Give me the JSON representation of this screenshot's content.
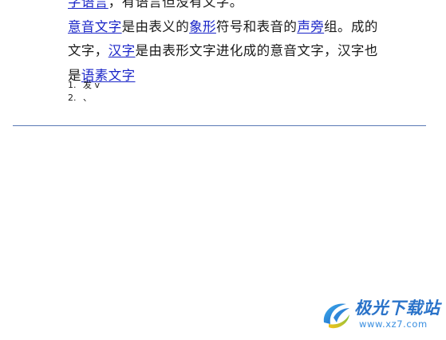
{
  "document": {
    "lines": [
      {
        "segments": [
          {
            "text": "字语言",
            "link": true
          },
          {
            "text": "，有语言但没有文字。",
            "link": false
          }
        ]
      },
      {
        "segments": [
          {
            "text": "意音文字",
            "link": true
          },
          {
            "text": "是由表义的",
            "link": false
          },
          {
            "text": "象形",
            "link": true
          },
          {
            "text": "符号和表音的",
            "link": false
          },
          {
            "text": "声旁",
            "link": true
          },
          {
            "text": "组。成的",
            "link": false
          }
        ]
      },
      {
        "segments": [
          {
            "text": "文字，",
            "link": false
          },
          {
            "text": "汉字",
            "link": true
          },
          {
            "text": "是由表形文字进化成的意音文字，汉字也",
            "link": false
          }
        ]
      },
      {
        "segments": [
          {
            "text": "是",
            "link": false
          },
          {
            "text": "语素文字",
            "link": true
          }
        ]
      }
    ],
    "list": [
      {
        "number": "1.",
        "text": "发 v"
      },
      {
        "number": "2.",
        "text": "、"
      }
    ]
  },
  "watermark": {
    "brand": "极光下载站",
    "url": "www.xz7.com"
  },
  "colors": {
    "link": "#1a25c8",
    "text": "#1a1a1a",
    "rule": "#5a79b5",
    "watermark_brand": "#2a73c9"
  }
}
